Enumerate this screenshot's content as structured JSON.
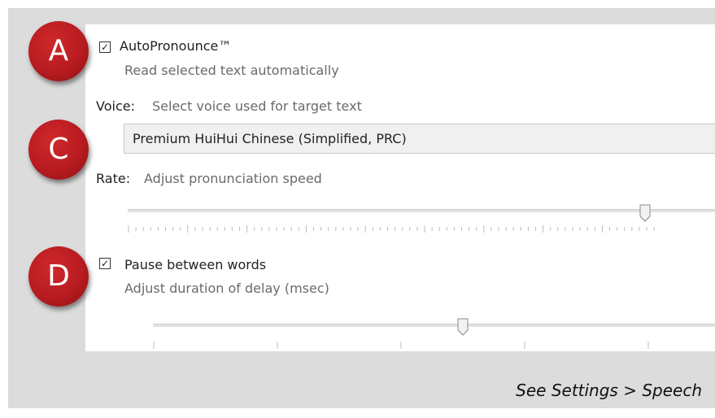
{
  "badges": {
    "a": "A",
    "c": "C",
    "d": "D"
  },
  "auto_pronounce": {
    "checked": true,
    "check_glyph": "✓",
    "label": "AutoPronounce™",
    "description": "Read selected text automatically"
  },
  "voice": {
    "label": "Voice:",
    "description": "Select voice used for target text",
    "selected": "Premium HuiHui Chinese (Simplified, PRC)"
  },
  "rate": {
    "label": "Rate:",
    "description": "Adjust pronunciation speed",
    "level": 0.82
  },
  "pause": {
    "checked": true,
    "check_glyph": "✓",
    "label": "Pause between words",
    "description": "Adjust duration of delay (msec)",
    "level": 0.55
  },
  "footer": "See Settings > Speech",
  "colors": {
    "badge": "#b71c20",
    "frame": "#dcdcdc"
  }
}
